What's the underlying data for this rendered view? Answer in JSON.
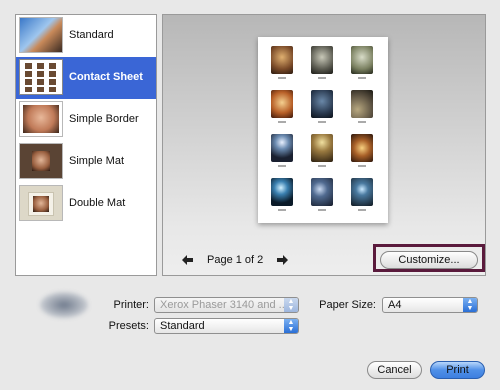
{
  "layouts": [
    {
      "label": "Standard",
      "selected": false
    },
    {
      "label": "Contact Sheet",
      "selected": true
    },
    {
      "label": "Simple Border",
      "selected": false
    },
    {
      "label": "Simple Mat",
      "selected": false
    },
    {
      "label": "Double Mat",
      "selected": false
    }
  ],
  "preview": {
    "page_label": "Page 1 of 2",
    "prev_icon": "arrow-left",
    "next_icon": "arrow-right",
    "customize_label": "Customize..."
  },
  "print_options": {
    "printer_label": "Printer:",
    "printer_value": "Xerox Phaser 3140 and ...",
    "presets_label": "Presets:",
    "presets_value": "Standard",
    "paper_size_label": "Paper Size:",
    "paper_size_value": "A4"
  },
  "buttons": {
    "cancel_label": "Cancel",
    "print_label": "Print"
  },
  "colors": {
    "selection": "#3a66d6",
    "highlight_outline": "#5a1a3c",
    "default_button": "#4f90e8"
  }
}
